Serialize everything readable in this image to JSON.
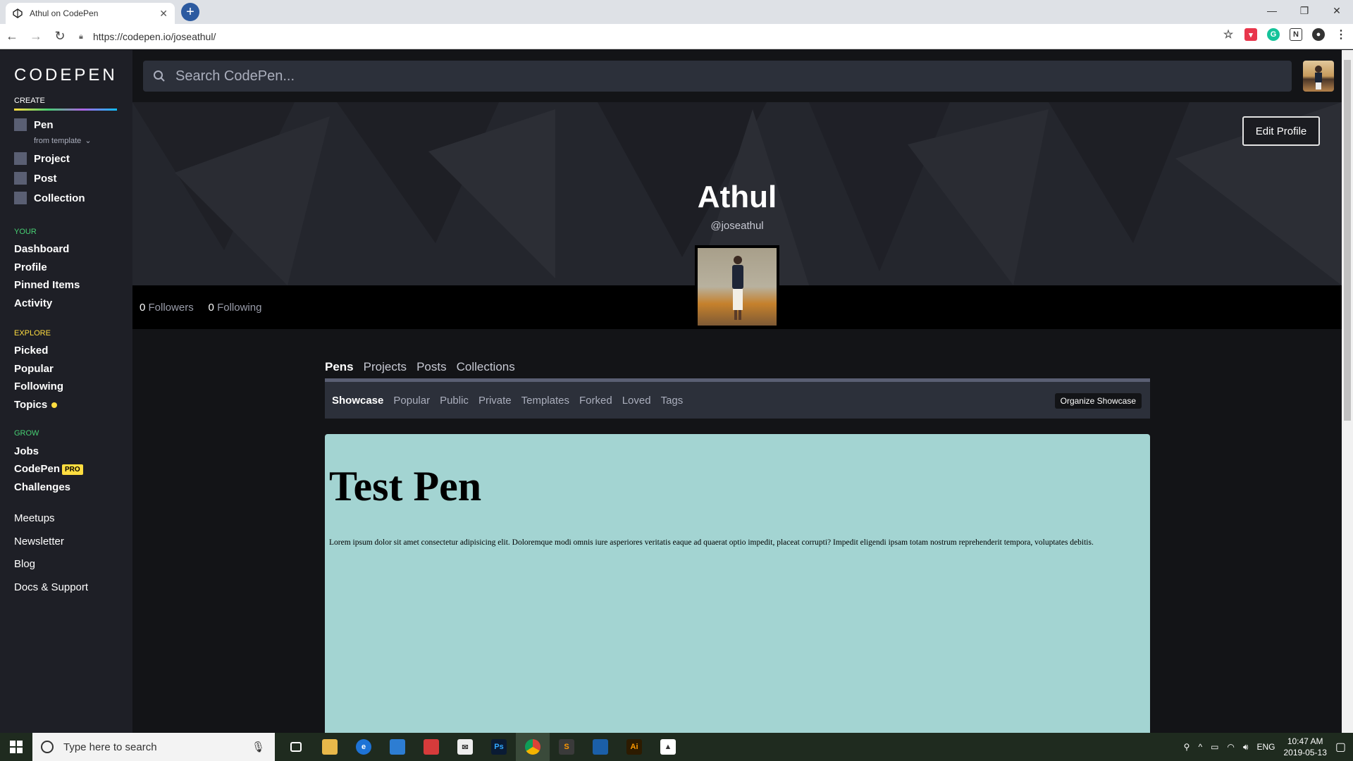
{
  "browser": {
    "tab_title": "Athul on CodePen",
    "url": "https://codepen.io/joseathul/"
  },
  "sidebar": {
    "logo": "CODEPEN",
    "create_heading": "CREATE",
    "create_items": [
      "Pen",
      "Project",
      "Post",
      "Collection"
    ],
    "from_template": "from template",
    "your_heading": "YOUR",
    "your_items": [
      "Dashboard",
      "Profile",
      "Pinned Items",
      "Activity"
    ],
    "explore_heading": "EXPLORE",
    "explore_items": [
      "Picked",
      "Popular",
      "Following",
      "Topics"
    ],
    "grow_heading": "GROW",
    "grow_items": [
      "Jobs",
      "CodePen",
      "Challenges"
    ],
    "pro_badge": "PRO",
    "footer_items": [
      "Meetups",
      "Newsletter",
      "Blog",
      "Docs & Support"
    ],
    "colors": {
      "your": "#47cf73",
      "explore": "#ffdd40",
      "grow": "#47cf73"
    }
  },
  "header": {
    "search_placeholder": "Search CodePen..."
  },
  "profile": {
    "name": "Athul",
    "handle": "@joseathul",
    "edit_button": "Edit Profile",
    "followers_count": "0",
    "followers_label": "Followers",
    "following_count": "0",
    "following_label": "Following"
  },
  "tabs": [
    "Pens",
    "Projects",
    "Posts",
    "Collections"
  ],
  "subtabs": [
    "Showcase",
    "Popular",
    "Public",
    "Private",
    "Templates",
    "Forked",
    "Loved",
    "Tags"
  ],
  "organize_button": "Organize Showcase",
  "pen_preview": {
    "heading": "Test Pen",
    "body": "Lorem ipsum dolor sit amet consectetur adipisicing elit. Doloremque modi omnis iure asperiores veritatis eaque ad quaerat optio impedit, placeat corrupti? Impedit eligendi ipsam totam nostrum reprehenderit tempora, voluptates debitis.",
    "background": "#a3d4d2"
  },
  "taskbar": {
    "search_placeholder": "Type here to search",
    "language": "ENG",
    "time": "10:47 AM",
    "date": "2019-05-13"
  }
}
